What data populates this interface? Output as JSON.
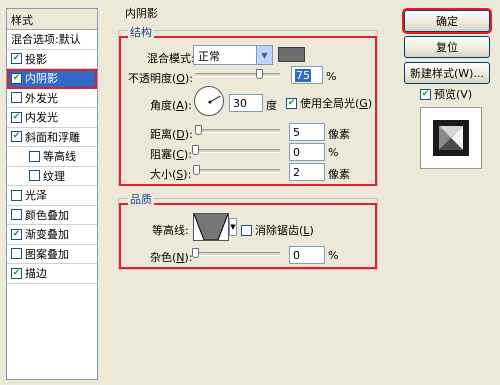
{
  "styles_panel": {
    "header": "样式",
    "items": [
      {
        "label": "混合选项:默认",
        "checkbox": false,
        "checked": false,
        "indent": false,
        "selected": false
      },
      {
        "label": "投影",
        "checkbox": true,
        "checked": true,
        "indent": false,
        "selected": false
      },
      {
        "label": "内阴影",
        "checkbox": true,
        "checked": true,
        "indent": false,
        "selected": true
      },
      {
        "label": "外发光",
        "checkbox": true,
        "checked": false,
        "indent": false,
        "selected": false
      },
      {
        "label": "内发光",
        "checkbox": true,
        "checked": true,
        "indent": false,
        "selected": false
      },
      {
        "label": "斜面和浮雕",
        "checkbox": true,
        "checked": true,
        "indent": false,
        "selected": false
      },
      {
        "label": "等高线",
        "checkbox": true,
        "checked": false,
        "indent": true,
        "selected": false
      },
      {
        "label": "纹理",
        "checkbox": true,
        "checked": false,
        "indent": true,
        "selected": false
      },
      {
        "label": "光泽",
        "checkbox": true,
        "checked": false,
        "indent": false,
        "selected": false
      },
      {
        "label": "颜色叠加",
        "checkbox": true,
        "checked": false,
        "indent": false,
        "selected": false
      },
      {
        "label": "渐变叠加",
        "checkbox": true,
        "checked": true,
        "indent": false,
        "selected": false
      },
      {
        "label": "图案叠加",
        "checkbox": true,
        "checked": false,
        "indent": false,
        "selected": false
      },
      {
        "label": "描边",
        "checkbox": true,
        "checked": true,
        "indent": false,
        "selected": false
      }
    ]
  },
  "inner_shadow": {
    "title": "内阴影",
    "structure": {
      "legend": "结构",
      "blend_mode_label": "混合模式:",
      "blend_mode_value": "正常",
      "shadow_color": "#6e6e6e",
      "opacity_label": "不透明度(",
      "opacity_key": "O",
      "opacity_value": "75",
      "opacity_unit": "%",
      "opacity_fraction": 0.75,
      "angle_label": "角度(",
      "angle_key": "A",
      "angle_value": "30",
      "angle_unit": "度",
      "global_light_label": "使用全局光(",
      "global_light_key": "G",
      "global_light_checked": true,
      "distance_label": "距离(",
      "distance_key": "D",
      "distance_value": "5",
      "distance_unit": "像素",
      "choke_label": "阻塞(",
      "choke_key": "C",
      "choke_value": "0",
      "choke_unit": "%",
      "size_label": "大小(",
      "size_key": "S",
      "size_value": "2",
      "size_unit": "像素"
    },
    "quality": {
      "legend": "品质",
      "contour_label": "等高线:",
      "antialias_label": "消除锯齿(",
      "antialias_key": "L",
      "antialias_checked": false,
      "noise_label": "杂色(",
      "noise_key": "N",
      "noise_value": "0",
      "noise_unit": "%"
    }
  },
  "buttons": {
    "ok": "确定",
    "reset": "复位",
    "new_style": "新建样式(W)...",
    "preview_label": "预览(V)",
    "preview_checked": true
  }
}
